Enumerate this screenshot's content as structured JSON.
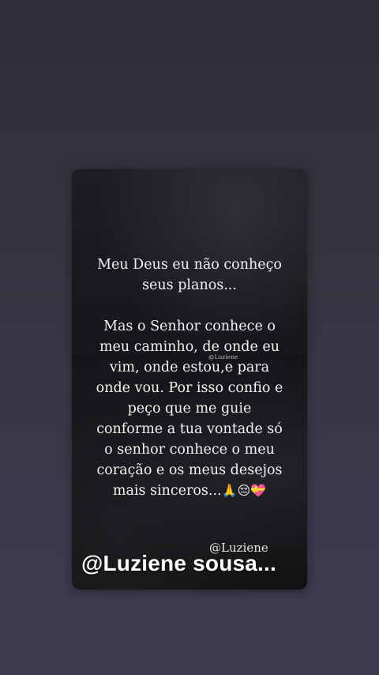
{
  "post": {
    "lines_a": [
      "Meu Deus eu não conheço",
      "seus planos..."
    ],
    "lines_b": [
      "Mas o Senhor conhece o",
      "meu caminho, de onde eu",
      "vim, onde estou,e para",
      "onde vou. Por isso confio e",
      "peço que me guie",
      "conforme a tua vontade só",
      "o senhor conhece o meu",
      "coração e os meus desejos",
      "mais sinceros..."
    ],
    "emojis": "🙏😔💝",
    "watermark_small": "@Luziene",
    "watermark_handle": "@Luziene"
  },
  "overlay": {
    "title": "@Luziene sousa..."
  },
  "colors": {
    "background_top": "#2f2e37",
    "background_bottom": "#3f3a52",
    "card": "#17171b",
    "text": "#f2f2f2"
  }
}
